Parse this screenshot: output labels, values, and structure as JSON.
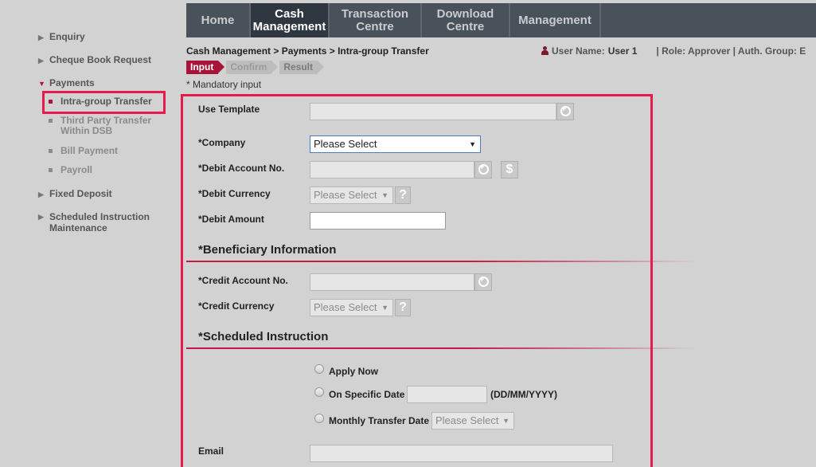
{
  "topnav": {
    "items": [
      {
        "label": "Home",
        "active": false
      },
      {
        "label": "Cash Management",
        "active": true
      },
      {
        "label": "Transaction Centre",
        "active": false
      },
      {
        "label": "Download Centre",
        "active": false
      },
      {
        "label": "Management",
        "active": false
      }
    ]
  },
  "sidebar": {
    "enquiry": "Enquiry",
    "cheque_book": "Cheque Book Request",
    "payments": "Payments",
    "intra_group": "Intra-group Transfer",
    "third_party": "Third Party Transfer Within DSB",
    "bill_payment": "Bill Payment",
    "payroll": "Payroll",
    "fixed_deposit": "Fixed Deposit",
    "scheduled": "Scheduled Instruction Maintenance"
  },
  "breadcrumb": "Cash Management > Payments > Intra-group Transfer",
  "user": {
    "label": "User Name:",
    "name": "User 1",
    "role": "| Role: Approver | Auth. Group: E"
  },
  "steps": [
    "Input",
    "Confirm",
    "Result"
  ],
  "mandatory_note": "* Mandatory input",
  "form": {
    "use_template": "Use Template",
    "company": "*Company",
    "company_value": "Please Select",
    "debit_account": "*Debit Account No.",
    "debit_currency": "*Debit Currency",
    "debit_currency_value": "Please Select",
    "debit_amount": "*Debit Amount",
    "beneficiary_title": "*Beneficiary Information",
    "credit_account": "*Credit Account No.",
    "credit_currency": "*Credit Currency",
    "credit_currency_value": "Please Select",
    "scheduled_title": "*Scheduled Instruction",
    "apply_now": "Apply Now",
    "on_specific_date": "On Specific Date",
    "date_format": "(DD/MM/YYYY)",
    "monthly_transfer_date": "Monthly Transfer Date",
    "monthly_value": "Please Select",
    "email": "Email"
  },
  "colors": {
    "accent": "#e8194b",
    "nav_bg": "#49515a",
    "nav_active": "#2f3740",
    "step_active": "#a81437"
  }
}
